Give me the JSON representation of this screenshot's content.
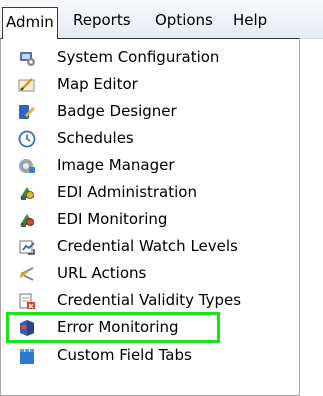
{
  "menubar": {
    "items": [
      {
        "label": "Admin",
        "active": true
      },
      {
        "label": "Reports"
      },
      {
        "label": "Options"
      },
      {
        "label": "Help"
      }
    ]
  },
  "dropdown": {
    "items": [
      {
        "label": "System Configuration",
        "icon": "system-config-icon"
      },
      {
        "label": "Map Editor",
        "icon": "map-editor-icon"
      },
      {
        "label": "Badge Designer",
        "icon": "badge-designer-icon"
      },
      {
        "label": "Schedules",
        "icon": "clock-icon"
      },
      {
        "label": "Image Manager",
        "icon": "image-manager-icon"
      },
      {
        "label": "EDI Administration",
        "icon": "edi-admin-icon"
      },
      {
        "label": "EDI Monitoring",
        "icon": "edi-monitor-icon"
      },
      {
        "label": "Credential Watch Levels",
        "icon": "watch-levels-icon"
      },
      {
        "label": "URL Actions",
        "icon": "url-actions-icon"
      },
      {
        "label": "Credential Validity Types",
        "icon": "validity-types-icon"
      },
      {
        "label": "Error Monitoring",
        "icon": "error-monitor-icon",
        "highlighted": true
      },
      {
        "label": "Custom Field Tabs",
        "icon": "custom-tabs-icon"
      }
    ]
  },
  "colors": {
    "highlight": "#19e619"
  }
}
